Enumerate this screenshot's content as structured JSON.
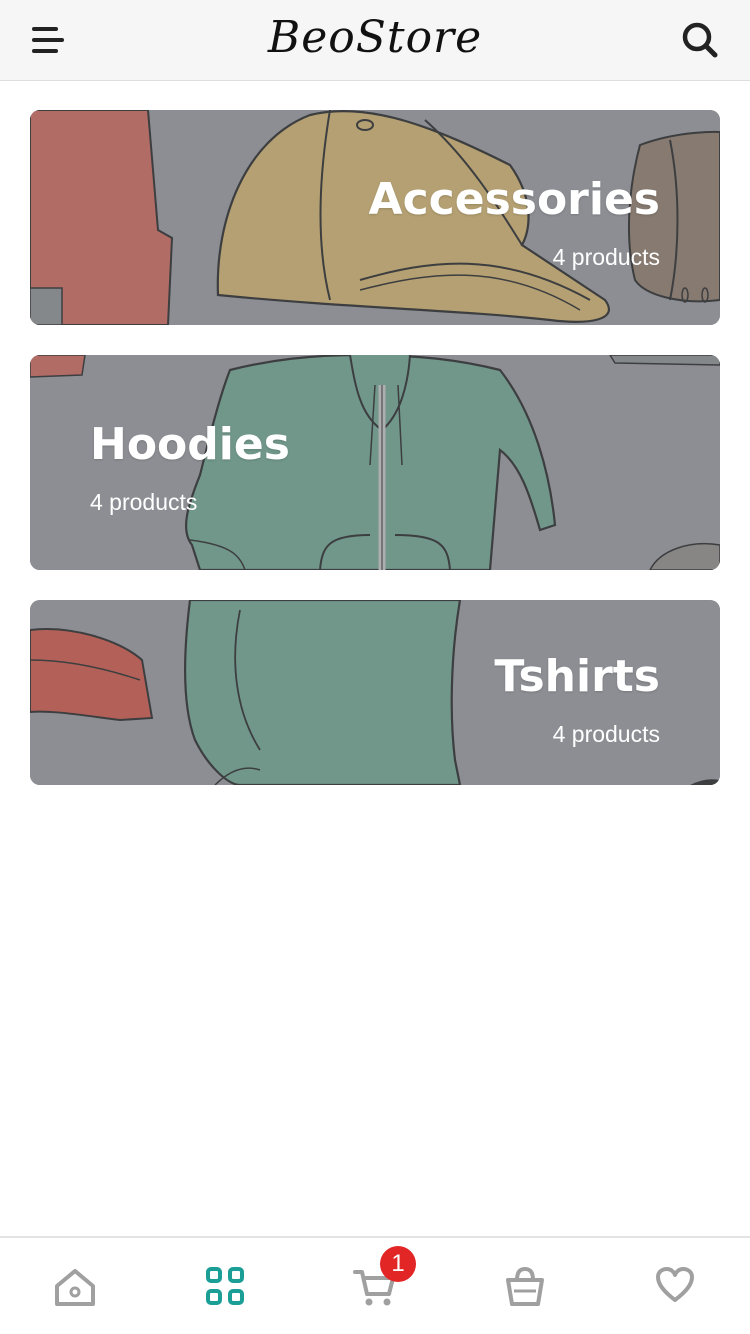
{
  "header": {
    "logo_text": "BeoStore",
    "menu_icon": "hamburger-menu-icon",
    "search_icon": "search-icon"
  },
  "categories": [
    {
      "name": "Accessories",
      "count_label": "4 products"
    },
    {
      "name": "Hoodies",
      "count_label": "4 products"
    },
    {
      "name": "Tshirts",
      "count_label": "4 products"
    }
  ],
  "tabbar": {
    "items": [
      {
        "icon": "home-icon",
        "active": false
      },
      {
        "icon": "categories-grid-icon",
        "active": true
      },
      {
        "icon": "cart-icon",
        "active": false,
        "badge": "1"
      },
      {
        "icon": "shopping-basket-icon",
        "active": false
      },
      {
        "icon": "heart-icon",
        "active": false
      }
    ],
    "active_color": "#1a9e96",
    "inactive_color": "#a0a0a0",
    "badge_color": "#e22525"
  }
}
